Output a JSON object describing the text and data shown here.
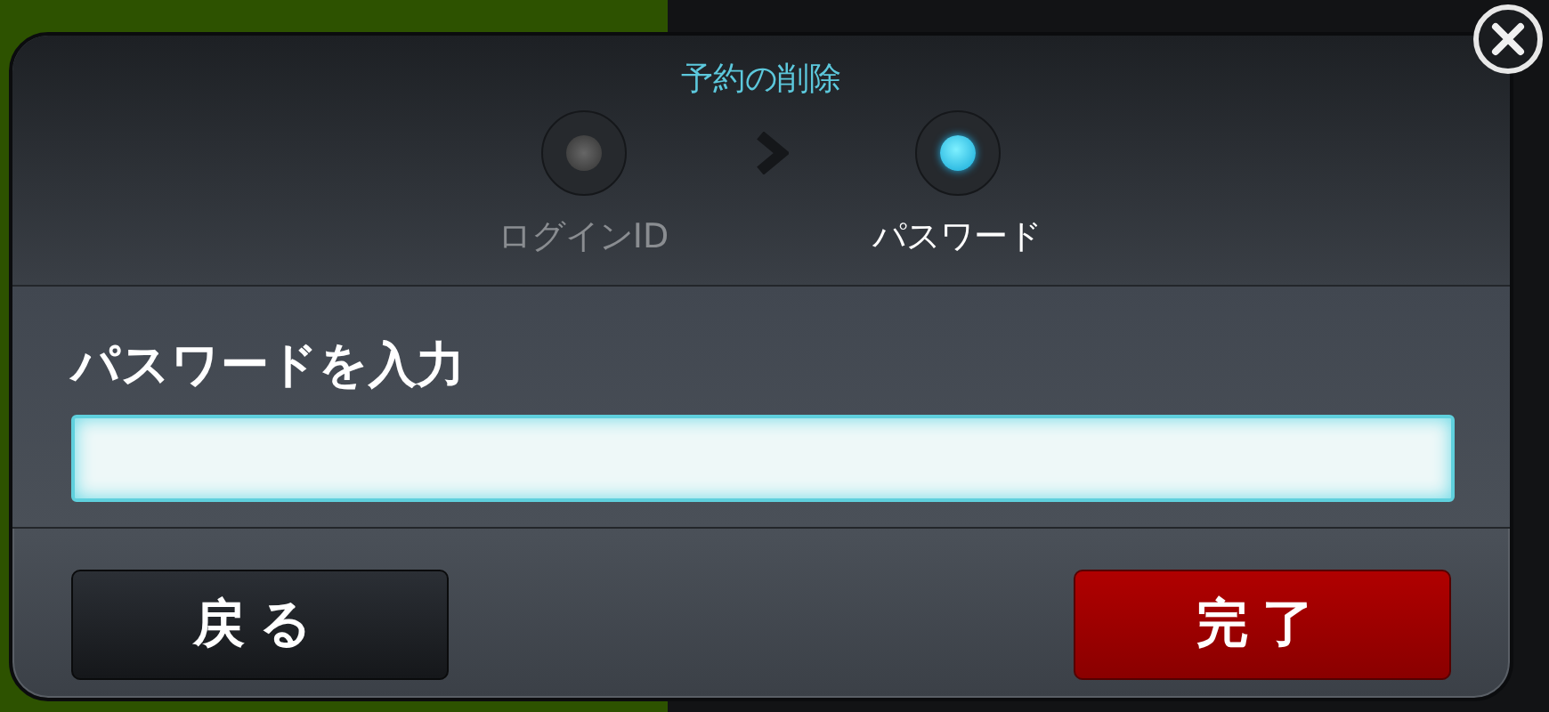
{
  "dialog": {
    "title": "予約の削除",
    "steps": [
      {
        "label": "ログインID",
        "selected": false
      },
      {
        "label": "パスワード",
        "selected": true
      }
    ],
    "field": {
      "label": "パスワードを入力"
    },
    "buttons": [
      {
        "label": "戻る",
        "kind": "secondary"
      },
      {
        "label": "完了",
        "kind": "primary"
      }
    ]
  }
}
